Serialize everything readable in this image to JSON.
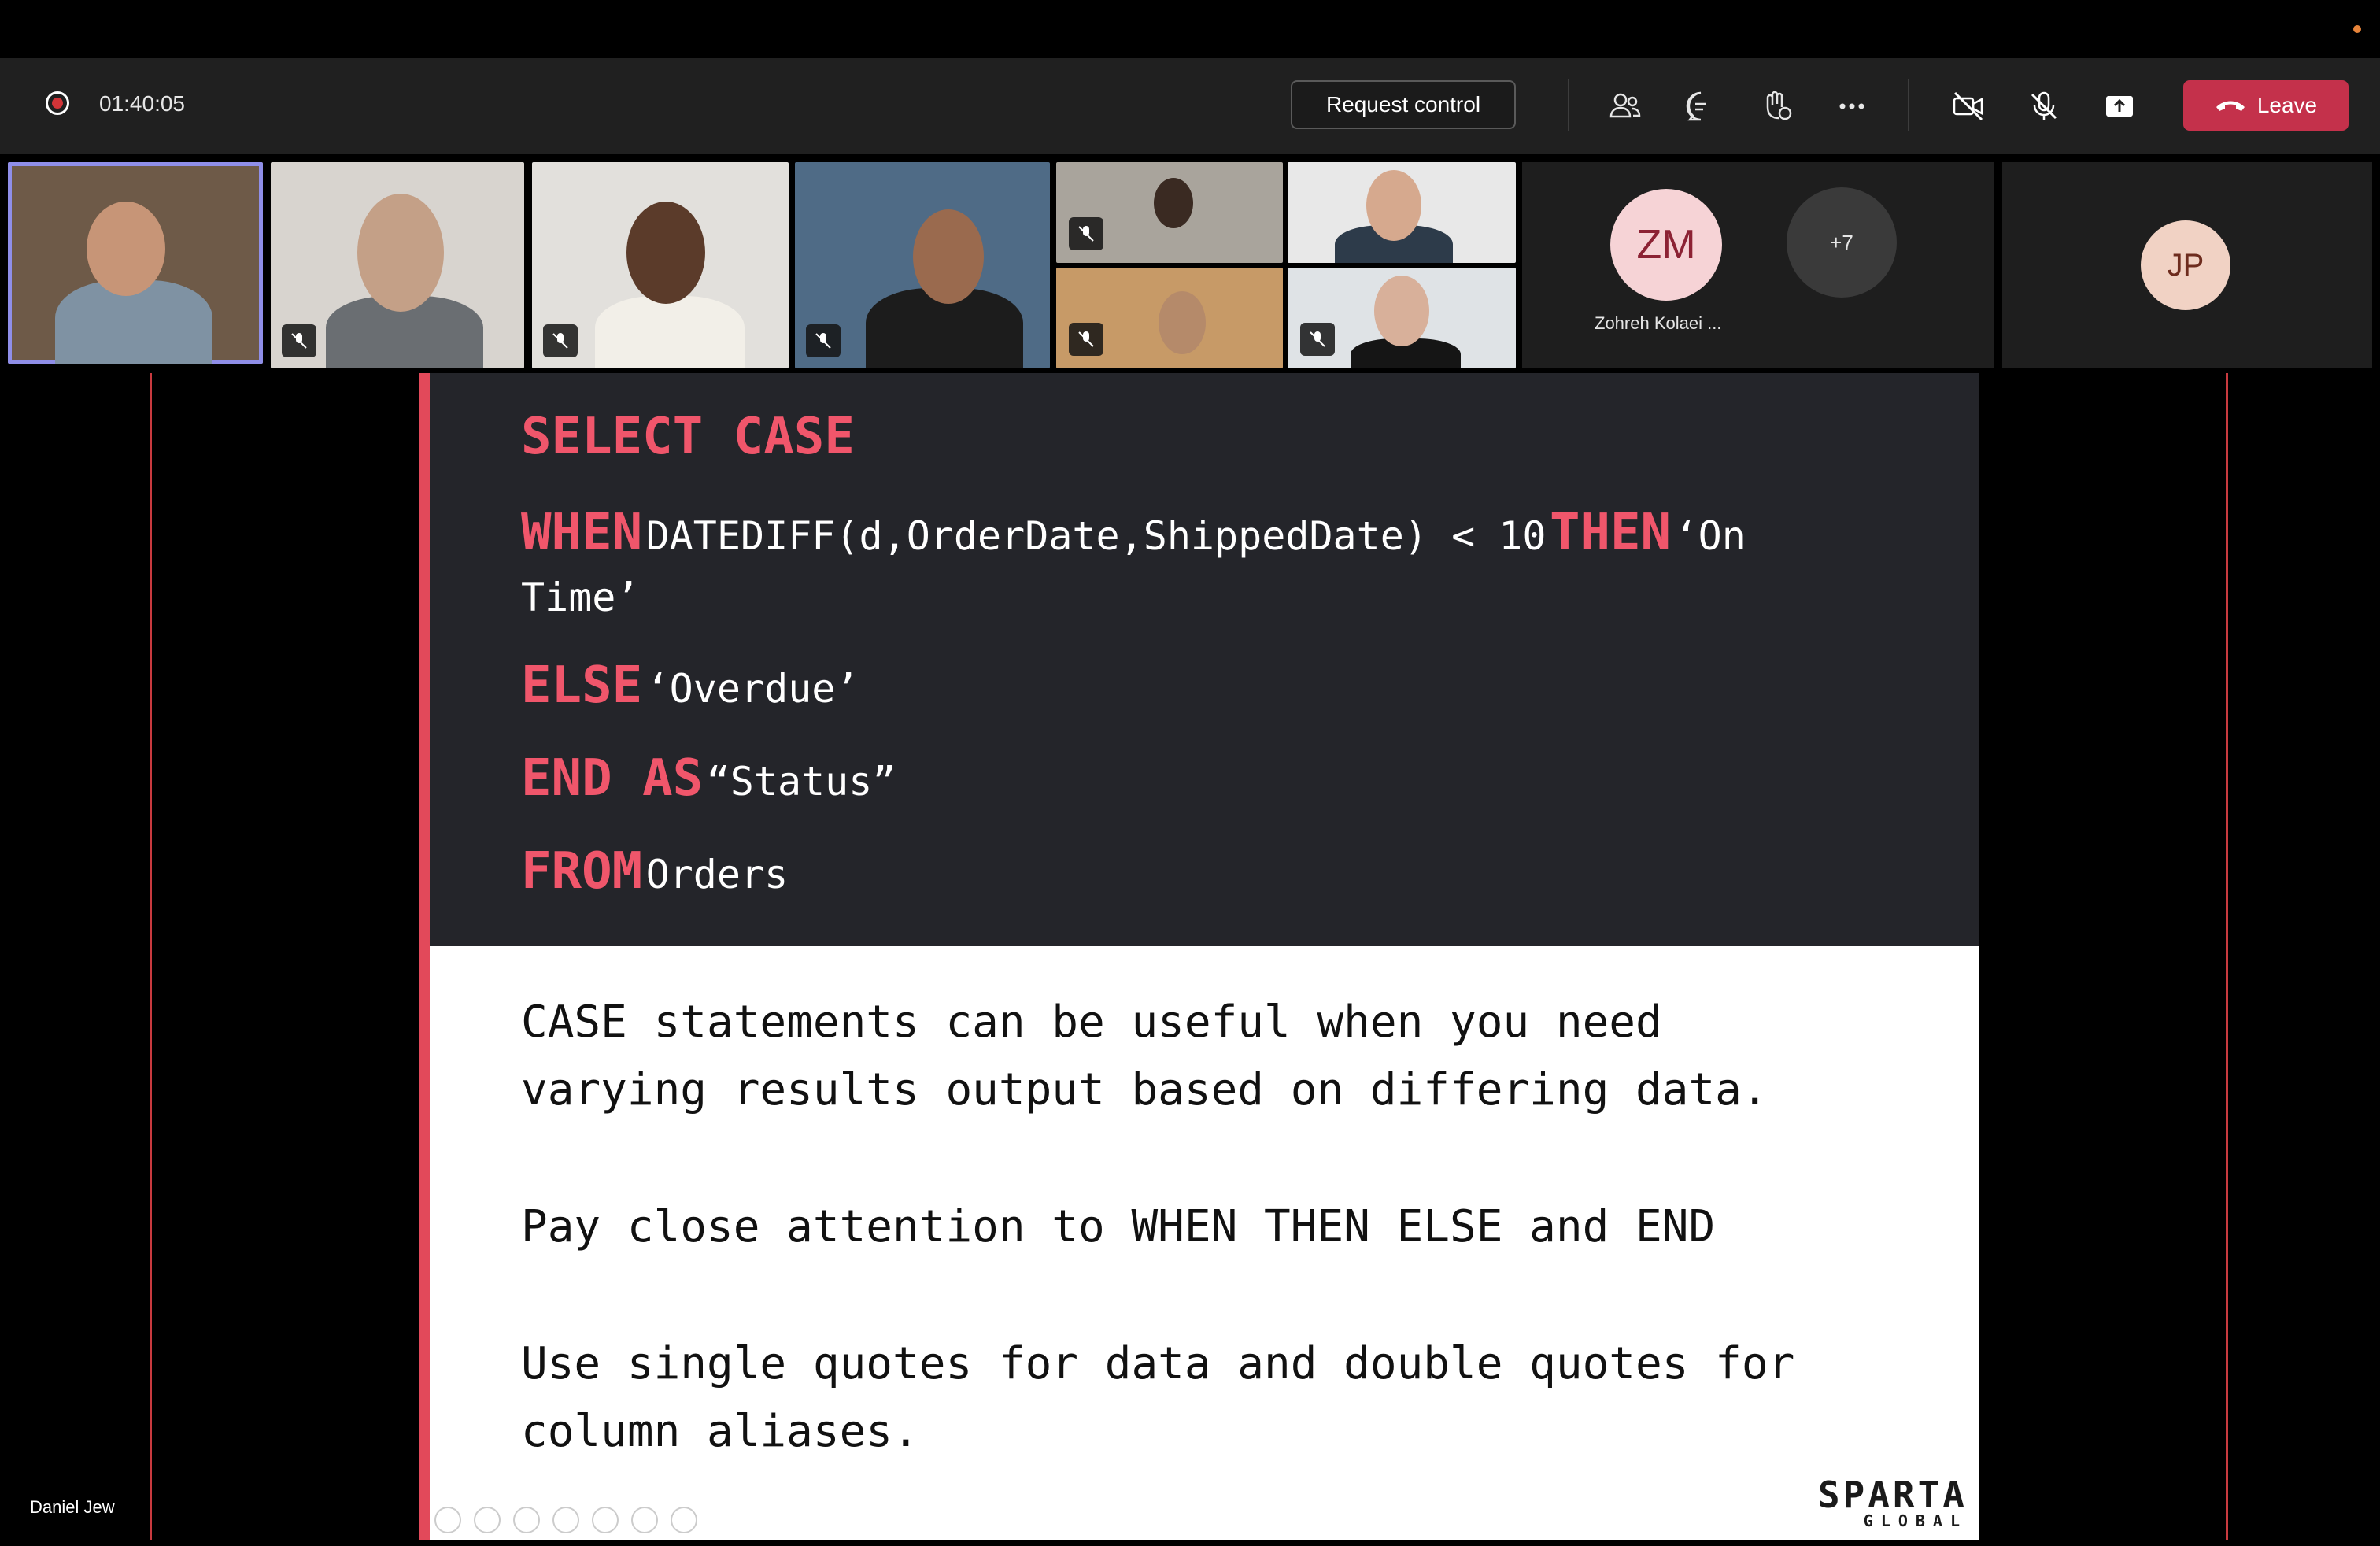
{
  "meeting": {
    "timer": "01:40:05",
    "request_control_label": "Request control",
    "leave_label": "Leave",
    "colors": {
      "leave": "#c4314b",
      "record": "#d13438",
      "active_outline": "#8f8ee8"
    }
  },
  "toolbar_icons": [
    "people-icon",
    "chat-icon",
    "raise-hand-icon",
    "more-icon",
    "camera-off-icon",
    "mic-off-icon",
    "share-screen-icon",
    "phone-hangup-icon"
  ],
  "participants": {
    "avatars": [
      {
        "initials": "ZM",
        "name": "Zohreh Kolaei ..."
      },
      {
        "initials": "+7"
      },
      {
        "initials": "JP"
      }
    ]
  },
  "slide": {
    "code": {
      "line1_kw": "SELECT CASE",
      "line2_kw": "WHEN",
      "line2_code": "DATEDIFF(d,OrderDate,ShippedDate) < 10",
      "line2_kw2": "THEN",
      "line2_code2": "‘On",
      "line2b": "Time’",
      "line3_kw": "ELSE",
      "line3_code": "‘Overdue’",
      "line4_kw": "END AS",
      "line4_code": "“Status”",
      "line5_kw": "FROM",
      "line5_code": "Orders"
    },
    "explanation": {
      "p1_line1": "CASE statements can be useful when you need",
      "p1_line2": "varying results output based on differing data.",
      "p2": "Pay close attention to WHEN THEN ELSE and END",
      "p3_line1": "Use single quotes for data and double quotes for",
      "p3_line2": "column aliases."
    },
    "logo": {
      "main": "SPARTA",
      "sub": "GLOBAL"
    },
    "colors": {
      "keyword": "#f0566b",
      "code_bg": "#24252a",
      "accent_bar": "#e2495a"
    }
  },
  "presenter": {
    "name": "Daniel Jew"
  }
}
